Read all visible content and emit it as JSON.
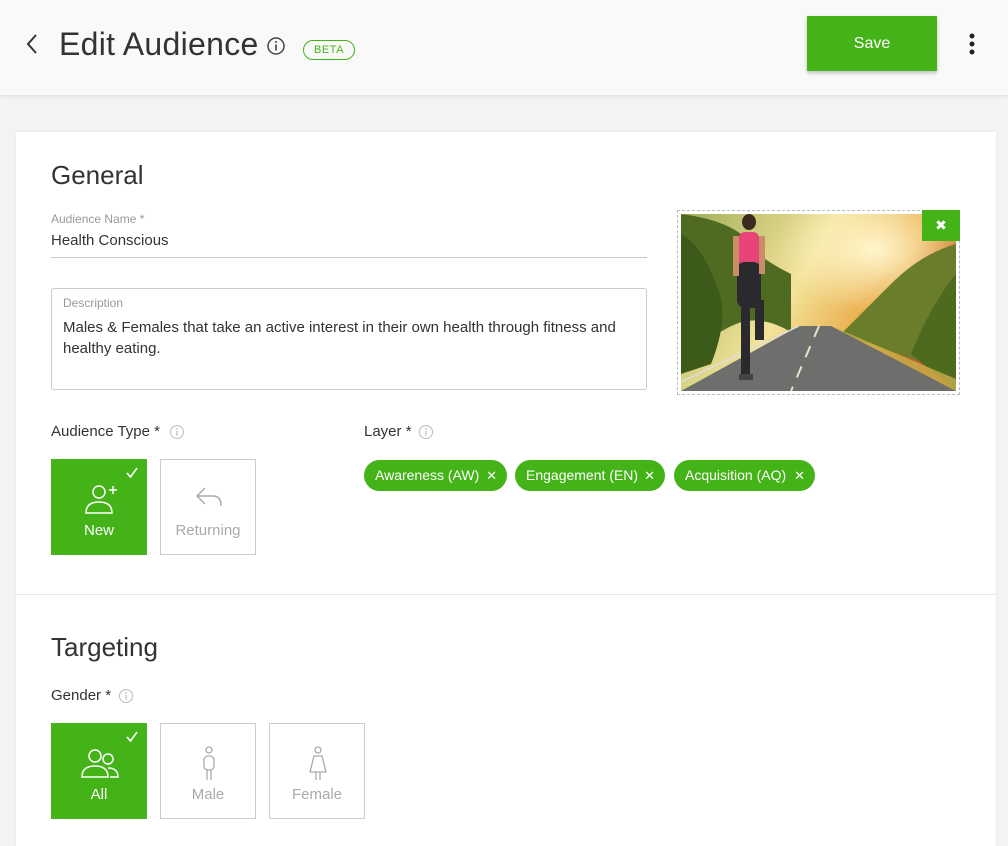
{
  "header": {
    "title": "Edit Audience",
    "badge": "BETA",
    "save_label": "Save"
  },
  "general": {
    "title": "General",
    "audience_name_label": "Audience Name *",
    "audience_name_value": "Health Conscious",
    "description_label": "Description",
    "description_value": "Males & Females that take an active interest in their own health through fitness and healthy eating.",
    "remove_image_label": "✖",
    "audience_type_label": "Audience Type *",
    "audience_types": [
      {
        "label": "New",
        "selected": true,
        "icon": "add-user-icon"
      },
      {
        "label": "Returning",
        "selected": false,
        "icon": "return-arrow-icon"
      }
    ],
    "layer_label": "Layer *",
    "layers": [
      {
        "label": "Awareness (AW)"
      },
      {
        "label": "Engagement (EN)"
      },
      {
        "label": "Acquisition (AQ)"
      }
    ]
  },
  "targeting": {
    "title": "Targeting",
    "gender_label": "Gender *",
    "genders": [
      {
        "label": "All",
        "selected": true,
        "icon": "people-icon"
      },
      {
        "label": "Male",
        "selected": false,
        "icon": "male-icon"
      },
      {
        "label": "Female",
        "selected": false,
        "icon": "female-icon"
      }
    ]
  },
  "colors": {
    "accent": "#44b318",
    "header_bg": "#f9f9f9",
    "page_bg": "#f3f3f3"
  }
}
